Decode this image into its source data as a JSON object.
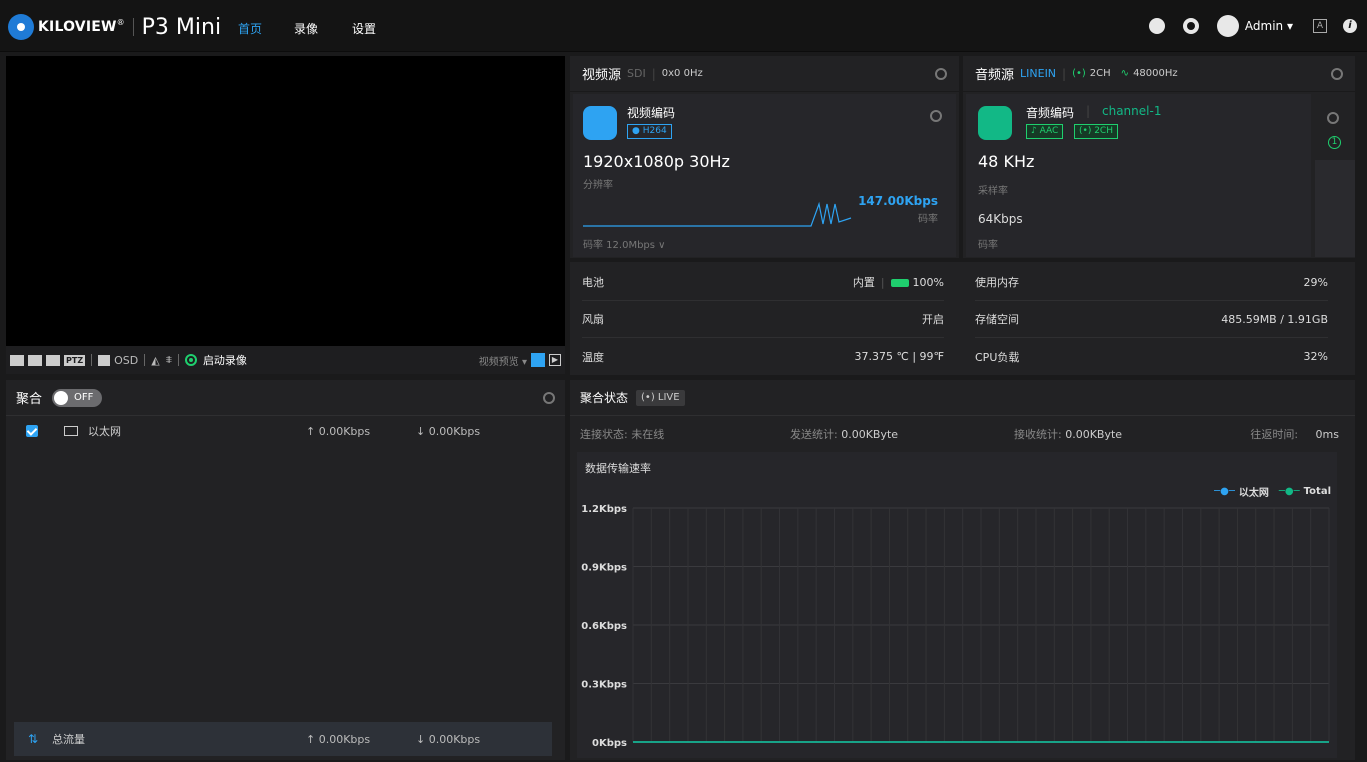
{
  "header": {
    "brand": "KILOVIEW",
    "product": "P3 Mini",
    "nav": [
      {
        "label": "首页",
        "active": true
      },
      {
        "label": "录像"
      },
      {
        "label": "设置"
      }
    ],
    "user": "Admin ▾"
  },
  "video_toolbar": {
    "ptz": "PTZ",
    "osd": "OSD",
    "record": "启动录像",
    "preview": "视频预览 ▾"
  },
  "video_source": {
    "title": "视频源",
    "type": "SDI",
    "signal": "0x0 0Hz"
  },
  "video_encode": {
    "title": "视频编码",
    "codec": "H264",
    "resolution": "1920x1080p 30Hz",
    "resolution_label": "分辨率",
    "bitrate_value": "147.00Kbps",
    "bitrate_label": "码率",
    "bitrate_setting": "码率  12.0Mbps  ∨"
  },
  "audio_source": {
    "title": "音频源",
    "type": "LINEIN",
    "channels": "2CH",
    "rate": "48000Hz"
  },
  "audio_encode": {
    "title": "音频编码",
    "channel": "channel-1",
    "codec": "AAC",
    "ch": "2CH",
    "sample": "48 KHz",
    "sample_label": "采样率",
    "bitrate": "64Kbps",
    "bitrate_label": "码率",
    "count": "1"
  },
  "status": {
    "left": [
      {
        "label": "电池",
        "value": "内置",
        "extra": "100%"
      },
      {
        "label": "风扇",
        "value": "开启"
      },
      {
        "label": "温度",
        "value": "37.375 ℃ | 99℉"
      }
    ],
    "right": [
      {
        "label": "使用内存",
        "value": "29%"
      },
      {
        "label": "存储空间",
        "value": "485.59MB / 1.91GB"
      },
      {
        "label": "CPU负载",
        "value": "32%"
      }
    ]
  },
  "aggregation": {
    "title": "聚合",
    "toggle": "OFF",
    "rows": [
      {
        "name": "以太网",
        "up": "↑ 0.00Kbps",
        "down": "↓ 0.00Kbps"
      }
    ],
    "total": {
      "name": "总流量",
      "up": "↑ 0.00Kbps",
      "down": "↓ 0.00Kbps"
    }
  },
  "agg_status": {
    "title": "聚合状态",
    "live": "LIVE",
    "conn_label": "连接状态:",
    "conn_value": "未在线",
    "send_label": "发送统计:",
    "send_value": "0.00KByte",
    "recv_label": "接收统计:",
    "recv_value": "0.00KByte",
    "rtt_label": "往返时间:",
    "rtt_value": "0ms",
    "chart_title": "数据传输速率"
  },
  "colors": {
    "accent": "#2ea3f2",
    "green": "#1fcf6e",
    "teal": "#12b886"
  },
  "chart_data": {
    "type": "line",
    "title": "数据传输速率",
    "y_ticks": [
      "1.2Kbps",
      "0.9Kbps",
      "0.6Kbps",
      "0.3Kbps",
      "0Kbps"
    ],
    "ylim": [
      0,
      1.2
    ],
    "legend_placement": "top-right",
    "series": [
      {
        "name": "以太网",
        "color": "#2ea3f2",
        "values": [
          0,
          0,
          0,
          0,
          0,
          0,
          0,
          0,
          0,
          0,
          0,
          0,
          0,
          0,
          0,
          0,
          0,
          0,
          0,
          0,
          0,
          0,
          0,
          0,
          0,
          0,
          0,
          0,
          0,
          0,
          0,
          0,
          0,
          0,
          0,
          0,
          0,
          0,
          0
        ]
      },
      {
        "name": "Total",
        "color": "#12b886",
        "values": [
          0,
          0,
          0,
          0,
          0,
          0,
          0,
          0,
          0,
          0,
          0,
          0,
          0,
          0,
          0,
          0,
          0,
          0,
          0,
          0,
          0,
          0,
          0,
          0,
          0,
          0,
          0,
          0,
          0,
          0,
          0,
          0,
          0,
          0,
          0,
          0,
          0,
          0,
          0
        ]
      }
    ],
    "grid": true
  }
}
